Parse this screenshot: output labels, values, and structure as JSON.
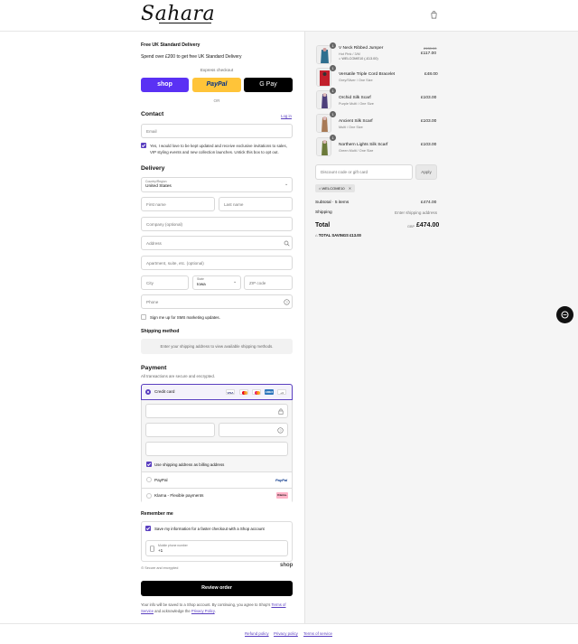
{
  "brand": {
    "logo": "Sahara"
  },
  "left": {
    "promo_title": "Free UK Standard Delivery",
    "promo_text": "Spend over £200 to get free UK Standard Delivery",
    "express_checkout": "Express checkout",
    "shop_pay": "shop",
    "paypal": "PayPal",
    "gpay": "G Pay",
    "or": "OR",
    "contact": {
      "heading": "Contact",
      "login": "Log in",
      "email_placeholder": "Email",
      "newsletter": "Yes, I would love to be kept updated and receive exclusive invitations to sales, VIP styling events and new collection launches. Untick this box to opt out."
    },
    "delivery": {
      "heading": "Delivery",
      "country_label": "Country/Region",
      "country_value": "United States",
      "first_name": "First name",
      "last_name": "Last name",
      "company": "Company (optional)",
      "address": "Address",
      "apartment": "Apartment, suite, etc. (optional)",
      "city": "City",
      "state_label": "State",
      "state_value": "Iowa",
      "zip": "ZIP code",
      "phone": "Phone",
      "sms": "Sign me up for SMS marketing updates."
    },
    "shipping": {
      "heading": "Shipping method",
      "placeholder": "Enter your shipping address to view available shipping methods."
    },
    "payment": {
      "heading": "Payment",
      "subtitle": "All transactions are secure and encrypted.",
      "credit_card": "Credit card",
      "more_cards": "+4",
      "billing": "Use shipping address as billing address",
      "paypal": "PayPal",
      "klarna": "Klarna - Flexible payments",
      "klarna_badge": "Klarna."
    },
    "remember": {
      "heading": "Remember me",
      "save": "Save my information for a faster checkout with a Shop account",
      "phone_label": "Mobile phone number",
      "phone_value": "+1",
      "secure": "Secure and encrypted",
      "shop": "shop"
    },
    "review_button": "Review order",
    "disclaimer_1": "Your info will be saved to a Shop account. By continuing, you agree to Shop's",
    "terms": "Terms of Service",
    "and": "and acknowledge the",
    "privacy": "Privacy Policy",
    "period": "."
  },
  "cart": {
    "items": [
      {
        "qty": "1",
        "name": "V Neck Ribbed Jumper",
        "variant": "Hot Pink / 3/M",
        "discount": "WELCOME10 (-£13.00)",
        "old_price": "£130.00",
        "price": "£117.00",
        "color": "#2f6f8f"
      },
      {
        "qty": "1",
        "name": "Versatile Triple Cord Bracelet",
        "variant": "Grey/Silver / One Size",
        "price": "£48.00",
        "color": "#c21f2b"
      },
      {
        "qty": "1",
        "name": "Orchid Silk Scarf",
        "variant": "Purple Multi / One Size",
        "price": "£103.00",
        "color": "#4c3f7a"
      },
      {
        "qty": "1",
        "name": "Ancient Silk Scarf",
        "variant": "Multi / One Size",
        "price": "£103.00",
        "color": "#a87a55"
      },
      {
        "qty": "1",
        "name": "Northern Lights Silk Scarf",
        "variant": "Green Multi / One Size",
        "price": "£103.00",
        "color": "#6c7a3a"
      }
    ],
    "discount_placeholder": "Discount code or gift card",
    "apply": "Apply",
    "code_tag": "WELCOME10",
    "subtotal_label": "Subtotal · 5 items",
    "subtotal_value": "£474.00",
    "shipping_label": "Shipping",
    "shipping_value": "Enter shipping address",
    "total_label": "Total",
    "currency": "GBP",
    "total_value": "£474.00",
    "savings_label": "TOTAL SAVINGS",
    "savings_value": "£13.00"
  },
  "footer": {
    "refund": "Refund policy",
    "privacy": "Privacy policy",
    "terms": "Terms of service"
  },
  "colors": {
    "accent": "#5a3fc0",
    "shop": "#5a31f4",
    "paypal": "#ffc439"
  },
  "icons": [
    "cart-icon",
    "search-icon",
    "help-icon",
    "lock-icon",
    "chat-icon",
    "tag-icon",
    "chevron-down-icon",
    "phone-icon"
  ]
}
